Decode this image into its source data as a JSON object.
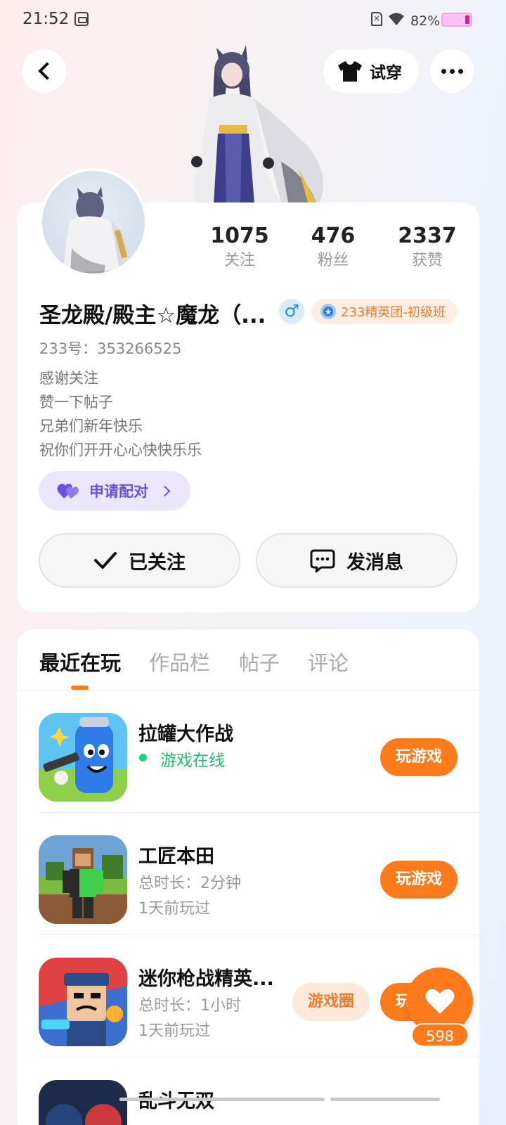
{
  "status_bar": {
    "time": "21:52",
    "battery": "82%",
    "icons": [
      "app-icon",
      "sim-icon",
      "wifi-icon",
      "battery-icon"
    ]
  },
  "header": {
    "tryon_label": "试穿",
    "icons": [
      "back-icon",
      "tshirt-icon",
      "more-icon"
    ]
  },
  "profile": {
    "stats": [
      {
        "value": "1075",
        "label": "关注"
      },
      {
        "value": "476",
        "label": "粉丝"
      },
      {
        "value": "2337",
        "label": "获赞"
      }
    ],
    "name": "圣龙殿/殿主☆魔龙（...",
    "gender_symbol": "♂",
    "rank_badge": "233精英团-初级班",
    "user_id": "233号：353266525",
    "bio": [
      "感谢关注",
      "赞一下帖子",
      "兄弟们新年快乐",
      "祝你们开开心心快快乐乐"
    ],
    "pair_label": "申请配对",
    "follow_label": "已关注",
    "message_label": "发消息"
  },
  "tabs": [
    {
      "label": "最近在玩",
      "active": true
    },
    {
      "label": "作品栏",
      "active": false
    },
    {
      "label": "帖子",
      "active": false
    },
    {
      "label": "评论",
      "active": false
    }
  ],
  "games": [
    {
      "name": "拉罐大作战",
      "status": "游戏在线",
      "play_label": "玩游戏"
    },
    {
      "name": "工匠本田",
      "duration": "总时长：2分钟",
      "last_played": "1天前玩过",
      "play_label": "玩游戏"
    },
    {
      "name": "迷你枪战精英...",
      "duration": "总时长：1小时",
      "last_played": "1天前玩过",
      "circle_label": "游戏圈",
      "play_label": "玩游戏"
    },
    {
      "name": "乱斗无双"
    }
  ],
  "like": {
    "count": "598"
  },
  "colors": {
    "accent": "#ff7a1a",
    "purple": "#6c52d8",
    "online": "#1fbf6f"
  }
}
